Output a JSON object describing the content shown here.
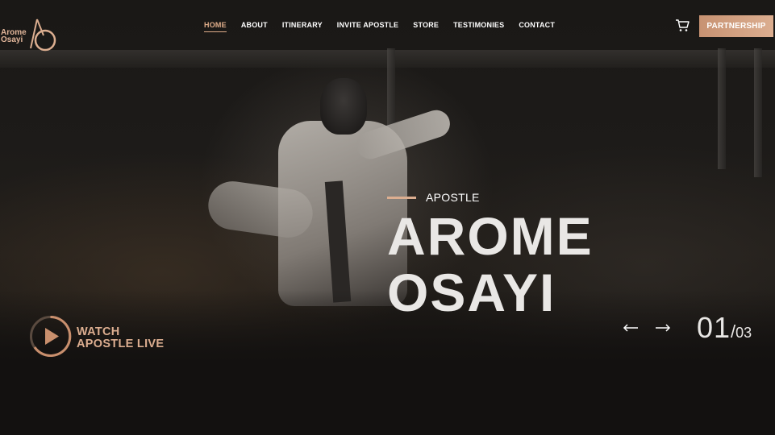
{
  "brand": {
    "logo_line1": "Arome",
    "logo_line2": "Osayi",
    "accent_color": "#dcae90"
  },
  "nav": {
    "items": [
      {
        "label": "HOME",
        "active": true
      },
      {
        "label": "ABOUT"
      },
      {
        "label": "ITINERARY"
      },
      {
        "label": "INVITE APOSTLE"
      },
      {
        "label": "STORE"
      },
      {
        "label": "TESTIMONIES"
      },
      {
        "label": "CONTACT"
      }
    ],
    "cart_icon": "cart-icon",
    "partnership_label": "PARTNERSHIP"
  },
  "hero": {
    "eyebrow": "APOSTLE",
    "title_line1": "AROME",
    "title_line2": "OSAYI"
  },
  "watch": {
    "icon": "play-icon",
    "line1": "WATCH",
    "line2": "APOSTLE LIVE"
  },
  "slider": {
    "prev_icon": "arrow-left-icon",
    "next_icon": "arrow-right-icon",
    "current": "01",
    "separator": "/",
    "total": "03"
  }
}
